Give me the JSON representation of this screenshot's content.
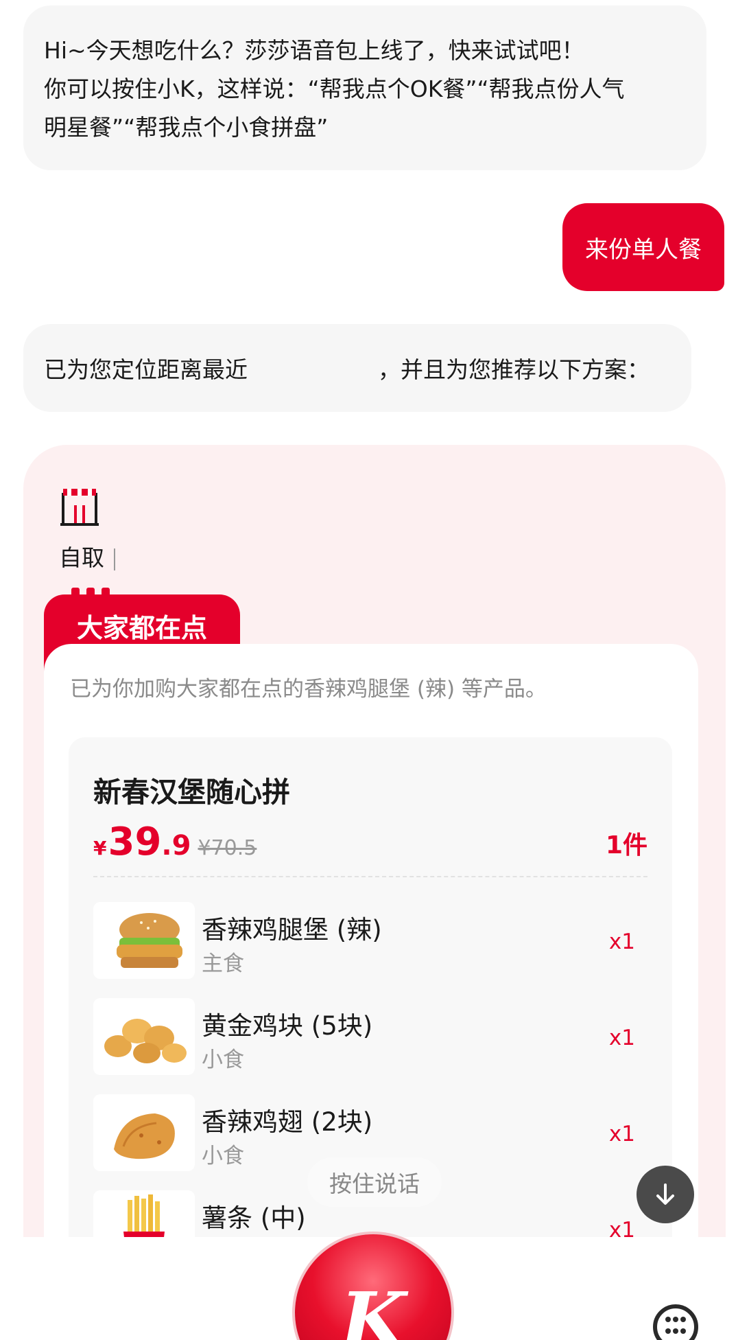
{
  "chat": {
    "greeting_lines": [
      "Hi~今天想吃什么？莎莎语音包上线了，快来试试吧！",
      "你可以按住小K，这样说：“帮我点个OK餐”“帮我点份人气",
      "明星餐”“帮我点个小食拼盘”"
    ],
    "user_message": "来份单人餐",
    "location_prefix": "已为您定位距离最近",
    "location_suffix": "，并且为您推荐以下方案："
  },
  "card": {
    "pickup_label": "自取",
    "tab_label": "大家都在点",
    "notice": "已为你加购大家都在点的香辣鸡腿堡 (辣) 等产品。",
    "combo": {
      "title": "新春汉堡随心拼",
      "currency": "¥",
      "price_int": "39",
      "price_dec": ".9",
      "original_price": "¥70.5",
      "quantity": "1件",
      "items": [
        {
          "name": "香辣鸡腿堡 (辣)",
          "category": "主食",
          "qty": "x1",
          "icon": "burger-icon"
        },
        {
          "name": "黄金鸡块 (5块)",
          "category": "小食",
          "qty": "x1",
          "icon": "nuggets-icon"
        },
        {
          "name": "香辣鸡翅 (2块)",
          "category": "小食",
          "qty": "x1",
          "icon": "wings-icon"
        },
        {
          "name": "薯条 (中)",
          "category": "",
          "qty": "x1",
          "icon": "fries-icon"
        }
      ]
    }
  },
  "controls": {
    "hold_to_talk": "按住说话",
    "k_button_letter": "K"
  },
  "colors": {
    "brand_red": "#e4002b",
    "card_bg": "#fdf0f1",
    "bubble_bg": "#f6f6f6"
  }
}
